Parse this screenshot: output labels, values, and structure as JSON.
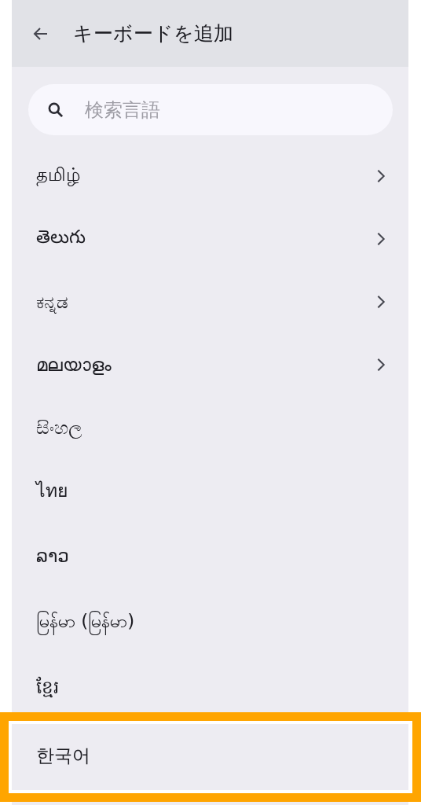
{
  "header": {
    "title": "キーボードを追加"
  },
  "search": {
    "placeholder": "検索言語"
  },
  "items": [
    {
      "label": "தமிழ்",
      "has_submenu": true,
      "highlighted": false
    },
    {
      "label": "తెలుగు",
      "has_submenu": true,
      "highlighted": false
    },
    {
      "label": "ಕನ್ನಡ",
      "has_submenu": true,
      "highlighted": false
    },
    {
      "label": "മലയാളം",
      "has_submenu": true,
      "highlighted": false
    },
    {
      "label": "සිංහල",
      "has_submenu": false,
      "highlighted": false
    },
    {
      "label": "ไทย",
      "has_submenu": false,
      "highlighted": false
    },
    {
      "label": "ລາວ",
      "has_submenu": false,
      "highlighted": false
    },
    {
      "label": "မြန်မာ (မြန်မာ)",
      "has_submenu": false,
      "highlighted": false
    },
    {
      "label": "ខ្មែរ",
      "has_submenu": false,
      "highlighted": false
    },
    {
      "label": "한국어",
      "has_submenu": false,
      "highlighted": true
    }
  ]
}
